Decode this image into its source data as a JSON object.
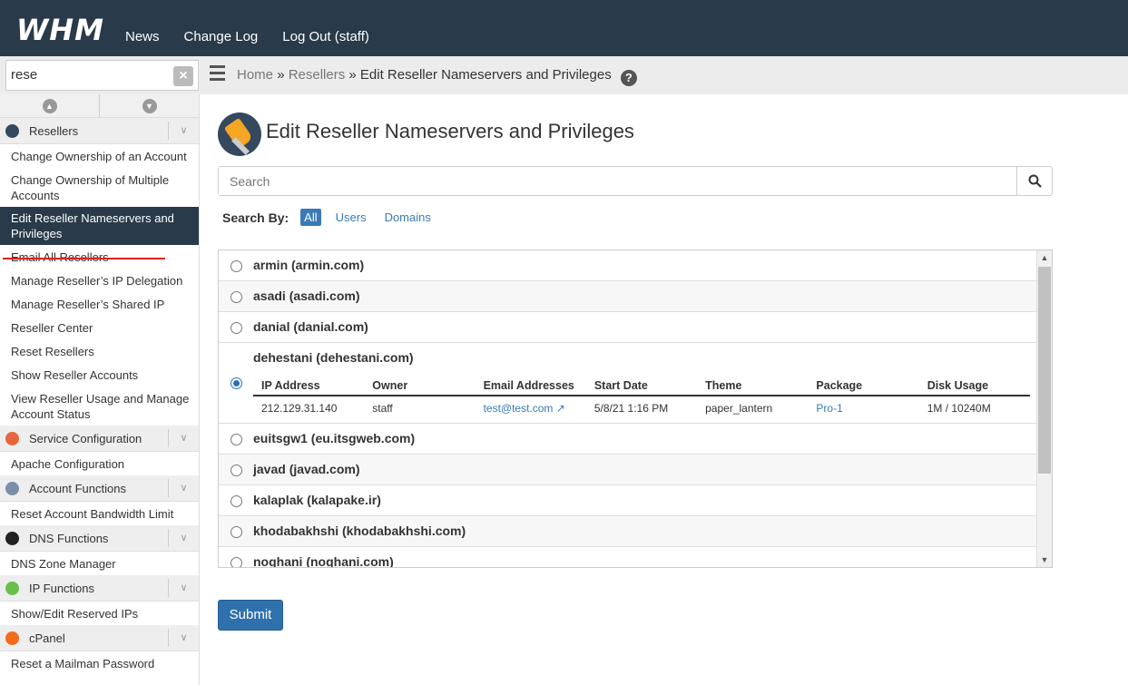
{
  "app": {
    "logo": "WHM"
  },
  "topnav": [
    "News",
    "Change Log",
    "Log Out (staff)"
  ],
  "sidebar_search": {
    "value": "rese"
  },
  "breadcrumb": {
    "home": "Home",
    "sep": "»",
    "resellers": "Resellers",
    "current": "Edit Reseller Nameservers and Privileges",
    "help": "?"
  },
  "sidebar": {
    "cat_resellers": "Resellers",
    "items_resellers": [
      "Change Ownership of an Account",
      "Change Ownership of Multiple Accounts",
      "Edit Reseller Nameservers and Privileges",
      "Email All Resellers",
      "Manage Reseller’s IP Delegation",
      "Manage Reseller’s Shared IP",
      "Reseller Center",
      "Reset Resellers",
      "Show Reseller Accounts",
      "View Reseller Usage and Manage Account Status"
    ],
    "cat_service": "Service Configuration",
    "item_service": "Apache Configuration",
    "cat_account": "Account Functions",
    "item_account": "Reset Account Bandwidth Limit",
    "cat_dns": "DNS Functions",
    "item_dns": "DNS Zone Manager",
    "cat_ip": "IP Functions",
    "item_ip": "Show/Edit Reserved IPs",
    "cat_cpanel": "cPanel",
    "item_cpanel": "Reset a Mailman Password"
  },
  "page": {
    "title": "Edit Reseller Nameservers and Privileges"
  },
  "search": {
    "placeholder": "Search"
  },
  "search_by": {
    "label": "Search By:",
    "all": "All",
    "users": "Users",
    "domains": "Domains"
  },
  "resellers": [
    "armin (armin.com)",
    "asadi (asadi.com)",
    "danial (danial.com)",
    "dehestani (dehestani.com)",
    "euitsgw1 (eu.itsgweb.com)",
    "javad (javad.com)",
    "kalaplak (kalapake.ir)",
    "khodabakhshi (khodabakhshi.com)",
    "noghani (noghani.com)"
  ],
  "detail": {
    "headers": [
      "IP Address",
      "Owner",
      "Email Addresses",
      "Start Date",
      "Theme",
      "Package",
      "Disk Usage"
    ],
    "values": [
      "212.129.31.140",
      "staff",
      "test@test.com",
      "5/8/21 1:16 PM",
      "paper_lantern",
      "Pro-1",
      "1M / 10240M"
    ]
  },
  "submit_label": "Submit",
  "colors": {
    "topbar": "#293a4a",
    "accent": "#2f71ad",
    "underline": "#e02020"
  }
}
